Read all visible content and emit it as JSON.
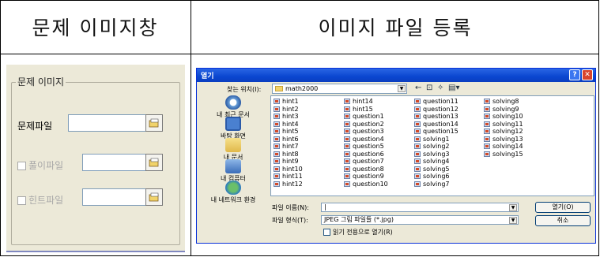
{
  "headers": {
    "left": "문제 이미지창",
    "right": "이미지 파일 등록"
  },
  "left_panel": {
    "group_title": "문제 이미지",
    "rows": [
      {
        "label": "문제파일",
        "checkbox": false,
        "enabled": true
      },
      {
        "label": "풀이파일",
        "checkbox": true,
        "enabled": false
      },
      {
        "label": "힌트파일",
        "checkbox": true,
        "enabled": false
      }
    ]
  },
  "dialog": {
    "title": "열기",
    "help_label": "?",
    "close_label": "✕",
    "look_in_label": "찾는 위치(I):",
    "look_in_value": "math2000",
    "places": [
      "내 최근 문서",
      "바탕 화면",
      "내 문서",
      "내 컴퓨터",
      "내 네트워크 환경"
    ],
    "files": [
      [
        "hint1",
        "hint2",
        "hint3",
        "hint4",
        "hint5",
        "hint6",
        "hint7",
        "hint8",
        "hint9",
        "hint10",
        "hint11",
        "hint12"
      ],
      [
        "hint14",
        "hint15",
        "question1",
        "question2",
        "question3",
        "question4",
        "question5",
        "question6",
        "question7",
        "question8",
        "question9",
        "question10"
      ],
      [
        "question11",
        "question12",
        "question13",
        "question14",
        "question15",
        "solving1",
        "solving2",
        "solving3",
        "solving4",
        "solving5",
        "solving6",
        "solving7"
      ],
      [
        "solving8",
        "solving9",
        "solving10",
        "solving11",
        "solving12",
        "solving13",
        "solving14",
        "solving15"
      ]
    ],
    "file_name_label": "파일 이름(N):",
    "file_name_value": "|",
    "file_type_label": "파일 형식(T):",
    "file_type_value": "JPEG 그림 파일들 (*.jpg)",
    "readonly_label": "읽기 전용으로 열기(R)",
    "open_button": "열기(O)",
    "cancel_button": "취소"
  }
}
